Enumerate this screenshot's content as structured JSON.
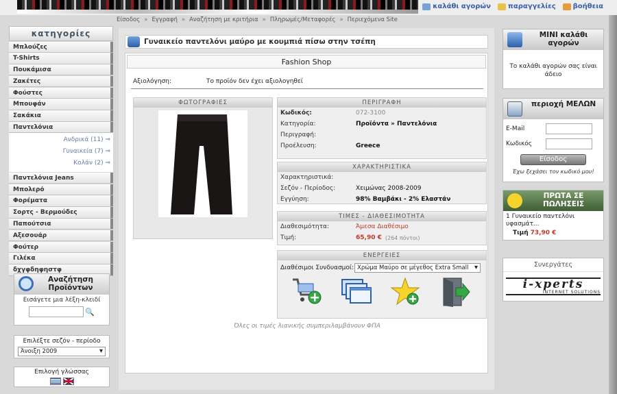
{
  "header": {
    "nav": [
      {
        "label": "καλάθι αγορών",
        "icon": "cart-icon"
      },
      {
        "label": "παραγγελίες",
        "icon": "folder-icon"
      },
      {
        "label": "βοήθεια",
        "icon": "tag-icon"
      }
    ]
  },
  "breadcrumb": [
    "Είσοδος",
    "Εγγραφή",
    "Αναζήτηση με κριτήρια",
    "Πληρωμές/Μεταφορές",
    "Περιεχόμενα Site"
  ],
  "sidebar": {
    "title": "κατηγορίες",
    "items": [
      "Μπλούζες",
      "T-Shirts",
      "Πουκάμισα",
      "Ζακέτες",
      "Φούστες",
      "Μπουφάν",
      "Σακάκια",
      "Παντελόνια"
    ],
    "sub_items": [
      "Ανδρικά (11) ⇒",
      "Γυναικεία (7) ⇒",
      "Κολάν (2) ⇒"
    ],
    "items2": [
      "Παντελόνια Jeans",
      "Μπολερό",
      "Φορέματα",
      "Σορτς - Βερμούδες",
      "Παπούτσια",
      "Αξεσουάρ",
      "Φούτερ",
      "Γιλέκα",
      "δχγφδηφηστφ"
    ]
  },
  "search": {
    "title": "Αναζήτηση Προϊόντων",
    "prompt": "Εισάγετε μια λέξη-κλειδί",
    "value": ""
  },
  "season": {
    "title": "Επιλέξτε σεζόν - περίοδο",
    "selected": "Άνοιξη 2009"
  },
  "language": {
    "title": "Επιλογή γλώσσας"
  },
  "product": {
    "page_title": "Γυναικείο παντελόνι μαύρο με κουμπιά πίσω στην τσέπη",
    "shop_name": "Fashion Shop",
    "rating_label": "Αξιολόγηση:",
    "rating_value": "Το προϊόν δεν έχει αξιολογηθεί",
    "photos_title": "ΦΩΤΟΓΡΑΦΙΕΣ",
    "description_title": "ΠΕΡΙΓΡΑΦΗ",
    "code_label": "Κωδικός:",
    "code_value": "072-3100",
    "category_label": "Κατηγορία:",
    "category_value": "Προϊόντα » Παντελόνια",
    "desc_label": "Περιγραφή:",
    "origin_label": "Προέλευση:",
    "origin_value": "Greece",
    "features_title": "ΧΑΡΑΚΤΗΡΙΣΤΙΚΑ",
    "features_label": "Χαρακτηριστικά:",
    "season_label": "Σεζόν - Περίοδος:",
    "season_value": "Χειμώνας 2008-2009",
    "warranty_label": "Εγγύηση:",
    "warranty_value": "98% Βαμβάκι - 2% Ελαστάν",
    "prices_title": "ΤΙΜΕΣ - ΔΙΑΘΕΣΙΜΟΤΗΤΑ",
    "availability_label": "Διαθεσιμότητα:",
    "availability_value": "Άμεσα Διαθέσιμο",
    "price_label": "Τιμή:",
    "price_value": "65,90 €",
    "points": "(264 πόντοι)",
    "actions_title": "ΕΝΕΡΓΕΙΕΣ",
    "combos_label": "Διαθέσιμοι Συνδυασμοί:",
    "combo_selected": "Χρώμα Μαύρο σε μέγεθος Extra Small",
    "vat_note": "Όλες οι τιμές λιανικής συμπεριλαμβάνουν ΦΠΑ"
  },
  "cart": {
    "title": "ΜΙΝΙ καλάθι αγορών",
    "empty_text": "Το καλάθι αγορών σας είναι άδειο"
  },
  "members": {
    "title": "περιοχή ΜΕΛΩΝ",
    "email_label": "E-Mail",
    "password_label": "Κωδικός",
    "login_button": "Είσοδος",
    "forgot": "Έχω ξεχάσει τον κωδικό μου!"
  },
  "bestsellers": {
    "title": "ΠΡΩΤΑ ΣΕ ΠΩΛΗΣΕΙΣ",
    "item_index": "1",
    "item_name": "Γυναικείο παντελόνι υφασμάτ...",
    "price_label": "Τιμή",
    "price_value": "73,90 €"
  },
  "partners": {
    "title": "Συνεργάτες",
    "logo_name": "i-xperts",
    "logo_sub": "INTERNET SOLUTIONS"
  },
  "colors": {
    "accent": "#3a5ea8",
    "price_red": "#c0392b",
    "panel": "#efefef"
  }
}
